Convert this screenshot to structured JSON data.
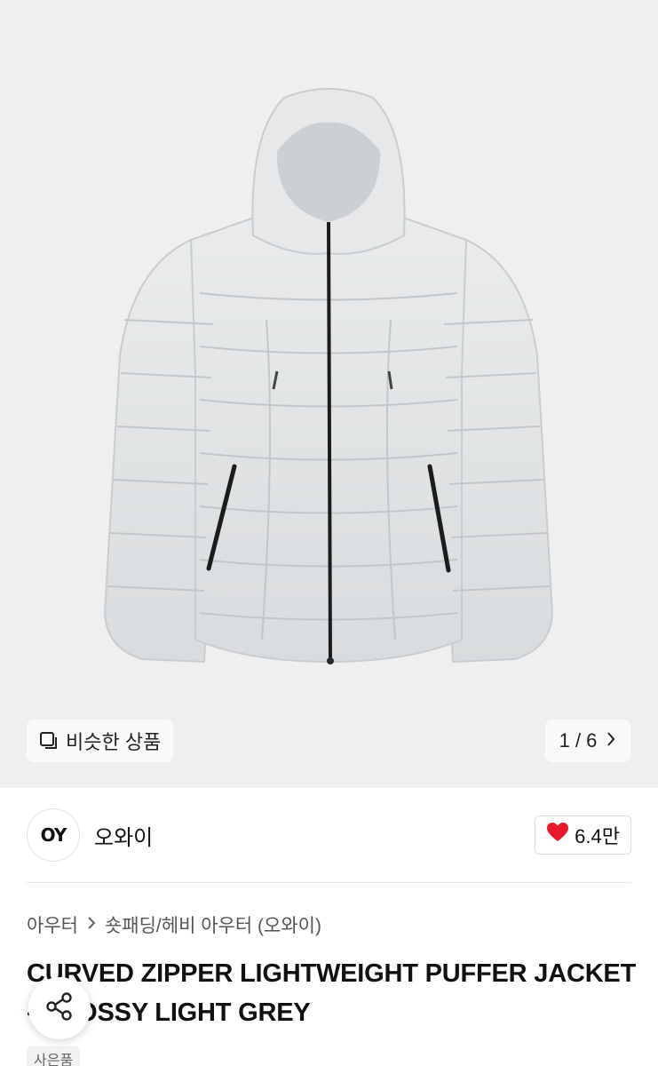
{
  "hero": {
    "image_alt": "product-photo-puffer-jacket",
    "similar_button_label": "비슷한 상품",
    "pager": {
      "text": "1 / 6"
    }
  },
  "shop": {
    "logo_text": "OY",
    "name": "오와이",
    "like_count": "6.4만",
    "like_color": "#e8192c"
  },
  "breadcrumb": {
    "category": "아우터",
    "subcategory": "숏패딩/헤비 아우터 (오와이)"
  },
  "product": {
    "title": "CURVED ZIPPER LIGHTWEIGHT PUFFER JACKET - GLOSSY LIGHT GREY",
    "badge": "사은품"
  },
  "icons": {
    "similar": "similar-products-icon",
    "pager_next": "chevron-right-icon",
    "like": "heart-icon",
    "breadcrumb_sep": "chevron-right-icon",
    "share": "share-icon"
  }
}
